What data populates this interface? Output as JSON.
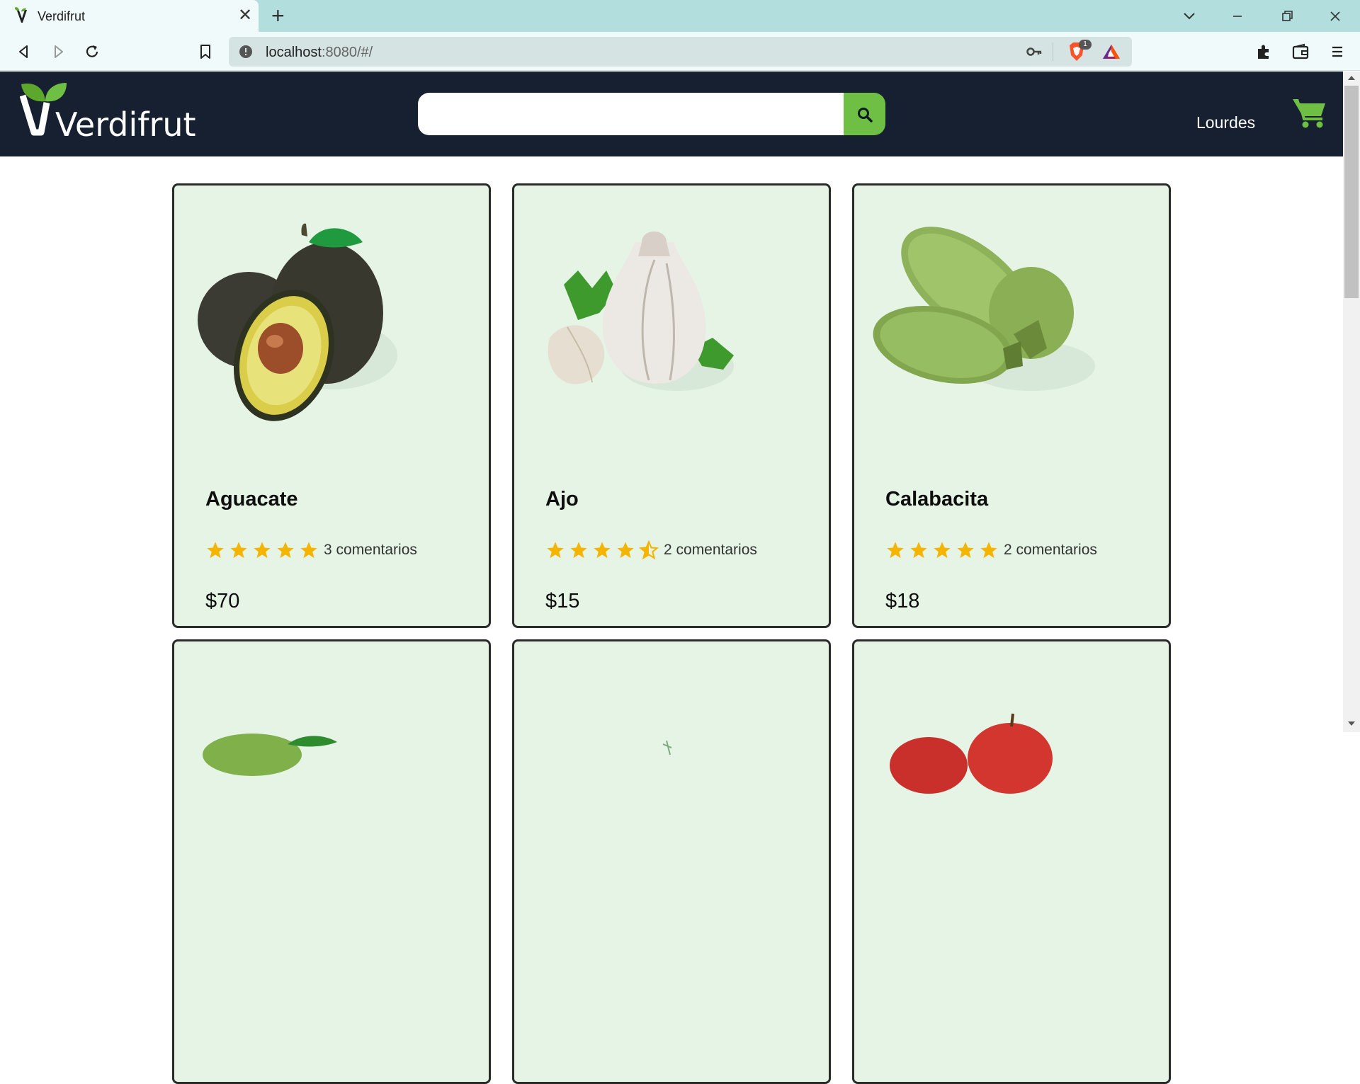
{
  "browser": {
    "tab_title": "Verdifrut",
    "url_host": "localhost",
    "url_rest": ":8080/#/",
    "brave_badge": "1",
    "icons": {
      "back": "back-icon",
      "forward": "forward-icon",
      "reload": "reload-icon",
      "bookmark": "bookmark-icon",
      "info": "info-icon",
      "key": "key-icon",
      "brave": "brave-shield-icon",
      "rewards": "brave-rewards-icon",
      "extensions": "extensions-icon",
      "wallet": "wallet-icon",
      "menu": "menu-icon"
    }
  },
  "header": {
    "logo_text": "Verdifrut",
    "search_placeholder": "",
    "search_value": "",
    "user_name": "Lourdes",
    "accent_color": "#6fbf44",
    "background_color": "#162030"
  },
  "products": [
    {
      "name": "Aguacate",
      "rating": 5,
      "comments": "3 comentarios",
      "price": "$70",
      "image": "avocado"
    },
    {
      "name": "Ajo",
      "rating": 4.5,
      "comments": "2 comentarios",
      "price": "$15",
      "image": "garlic"
    },
    {
      "name": "Calabacita",
      "rating": 5,
      "comments": "2 comentarios",
      "price": "$18",
      "image": "zucchini"
    },
    {
      "name": "",
      "rating": null,
      "comments": "",
      "price": "",
      "image": "lime"
    },
    {
      "name": "",
      "rating": null,
      "comments": "",
      "price": "",
      "image": "herb"
    },
    {
      "name": "",
      "rating": null,
      "comments": "",
      "price": "",
      "image": "apple"
    }
  ],
  "colors": {
    "card_bg": "#e6f4e6",
    "star": "#f5b400",
    "tab_bar": "#b2dede"
  }
}
